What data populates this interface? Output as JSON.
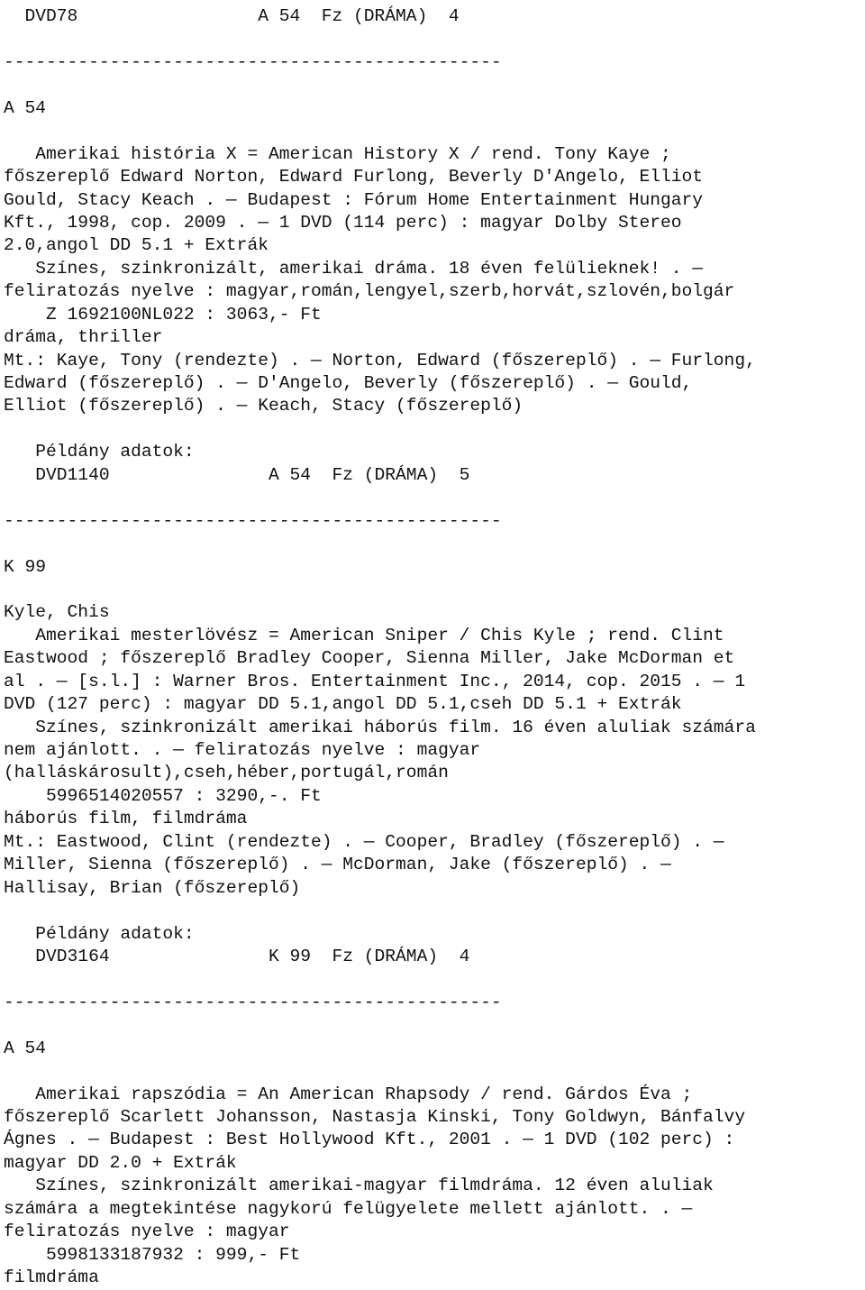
{
  "document": {
    "kind": "library-catalog-printout",
    "language": "hu",
    "separator_rule": "-----------------------------------------------",
    "copy_data_label": "Példány adatok:",
    "records": [
      {
        "id": "record-1",
        "shelf_header": {
          "copy_id": "DVD78",
          "call_number": "A 54",
          "binding": "Fz",
          "genre_code": "(DRÁMA)",
          "count": "4",
          "line": "  DVD78                 A 54  Fz (DRÁMA)  4"
        },
        "call_number_heading": "A 54",
        "body_lines": [
          "   Amerikai história X = American History X / rend. Tony Kaye ;",
          "főszereplő Edward Norton, Edward Furlong, Beverly D'Angelo, Elliot",
          "Gould, Stacy Keach . — Budapest : Fórum Home Entertainment Hungary",
          "Kft., 1998, cop. 2009 . — 1 DVD (114 perc) : magyar Dolby Stereo",
          "2.0,angol DD 5.1 + Extrák",
          "   Színes, szinkronizált, amerikai dráma. 18 éven felülieknek! . —",
          "feliratozás nyelve : magyar,román,lengyel,szerb,horvát,szlovén,bolgár",
          "    Z 1692100NL022 : 3063,- Ft",
          "dráma, thriller",
          "Mt.: Kaye, Tony (rendezte) . — Norton, Edward (főszereplő) . — Furlong,",
          "Edward (főszereplő) . — D'Angelo, Beverly (főszereplő) . — Gould,",
          "Elliot (főszereplő) . — Keach, Stacy (főszereplő)"
        ],
        "copy_block": {
          "label": "   Példány adatok:",
          "row": "   DVD1140               A 54  Fz (DRÁMA)  5",
          "copy_id": "DVD1140",
          "call_number": "A 54",
          "binding": "Fz",
          "genre_code": "(DRÁMA)",
          "count": "5"
        }
      },
      {
        "id": "record-2",
        "call_number_heading": "K 99",
        "author_heading": "Kyle, Chis",
        "body_lines": [
          "   Amerikai mesterlövész = American Sniper / Chis Kyle ; rend. Clint",
          "Eastwood ; főszereplő Bradley Cooper, Sienna Miller, Jake McDorman et",
          "al . — [s.l.] : Warner Bros. Entertainment Inc., 2014, cop. 2015 . — 1",
          "DVD (127 perc) : magyar DD 5.1,angol DD 5.1,cseh DD 5.1 + Extrák",
          "   Színes, szinkronizált amerikai háborús film. 16 éven aluliak számára",
          "nem ajánlott. . — feliratozás nyelve : magyar",
          "(halláskárosult),cseh,héber,portugál,román",
          "    5996514020557 : 3290,-. Ft",
          "háborús film, filmdráma",
          "Mt.: Eastwood, Clint (rendezte) . — Cooper, Bradley (főszereplő) . —",
          "Miller, Sienna (főszereplő) . — McDorman, Jake (főszereplő) . —",
          "Hallisay, Brian (főszereplő)"
        ],
        "copy_block": {
          "label": "   Példány adatok:",
          "row": "   DVD3164               K 99  Fz (DRÁMA)  4",
          "copy_id": "DVD3164",
          "call_number": "K 99",
          "binding": "Fz",
          "genre_code": "(DRÁMA)",
          "count": "4"
        }
      },
      {
        "id": "record-3",
        "call_number_heading": "A 54",
        "body_lines": [
          "   Amerikai rapszódia = An American Rhapsody / rend. Gárdos Éva ;",
          "főszereplő Scarlett Johansson, Nastasja Kinski, Tony Goldwyn, Bánfalvy",
          "Ágnes . — Budapest : Best Hollywood Kft., 2001 . — 1 DVD (102 perc) :",
          "magyar DD 2.0 + Extrák",
          "   Színes, szinkronizált amerikai-magyar filmdráma. 12 éven aluliak",
          "számára a megtekintése nagykorú felügyelete mellett ajánlott. . —",
          "feliratozás nyelve : magyar",
          "    5998133187932 : 999,- Ft",
          "filmdráma"
        ]
      }
    ]
  },
  "rendered_lines": [
    "  DVD78                 A 54  Fz (DRÁMA)  4",
    "",
    "-----------------------------------------------",
    "",
    "A 54",
    "",
    "   Amerikai história X = American History X / rend. Tony Kaye ;",
    "főszereplő Edward Norton, Edward Furlong, Beverly D'Angelo, Elliot",
    "Gould, Stacy Keach . — Budapest : Fórum Home Entertainment Hungary",
    "Kft., 1998, cop. 2009 . — 1 DVD (114 perc) : magyar Dolby Stereo",
    "2.0,angol DD 5.1 + Extrák",
    "   Színes, szinkronizált, amerikai dráma. 18 éven felülieknek! . —",
    "feliratozás nyelve : magyar,román,lengyel,szerb,horvát,szlovén,bolgár",
    "    Z 1692100NL022 : 3063,- Ft",
    "dráma, thriller",
    "Mt.: Kaye, Tony (rendezte) . — Norton, Edward (főszereplő) . — Furlong,",
    "Edward (főszereplő) . — D'Angelo, Beverly (főszereplő) . — Gould,",
    "Elliot (főszereplő) . — Keach, Stacy (főszereplő)",
    "",
    "   Példány adatok:",
    "   DVD1140               A 54  Fz (DRÁMA)  5",
    "",
    "-----------------------------------------------",
    "",
    "K 99",
    "",
    "Kyle, Chis",
    "   Amerikai mesterlövész = American Sniper / Chis Kyle ; rend. Clint",
    "Eastwood ; főszereplő Bradley Cooper, Sienna Miller, Jake McDorman et",
    "al . — [s.l.] : Warner Bros. Entertainment Inc., 2014, cop. 2015 . — 1",
    "DVD (127 perc) : magyar DD 5.1,angol DD 5.1,cseh DD 5.1 + Extrák",
    "   Színes, szinkronizált amerikai háborús film. 16 éven aluliak számára",
    "nem ajánlott. . — feliratozás nyelve : magyar",
    "(halláskárosult),cseh,héber,portugál,román",
    "    5996514020557 : 3290,-. Ft",
    "háborús film, filmdráma",
    "Mt.: Eastwood, Clint (rendezte) . — Cooper, Bradley (főszereplő) . —",
    "Miller, Sienna (főszereplő) . — McDorman, Jake (főszereplő) . —",
    "Hallisay, Brian (főszereplő)",
    "",
    "   Példány adatok:",
    "   DVD3164               K 99  Fz (DRÁMA)  4",
    "",
    "-----------------------------------------------",
    "",
    "A 54",
    "",
    "   Amerikai rapszódia = An American Rhapsody / rend. Gárdos Éva ;",
    "főszereplő Scarlett Johansson, Nastasja Kinski, Tony Goldwyn, Bánfalvy",
    "Ágnes . — Budapest : Best Hollywood Kft., 2001 . — 1 DVD (102 perc) :",
    "magyar DD 2.0 + Extrák",
    "   Színes, szinkronizált amerikai-magyar filmdráma. 12 éven aluliak",
    "számára a megtekintése nagykorú felügyelete mellett ajánlott. . —",
    "feliratozás nyelve : magyar",
    "    5998133187932 : 999,- Ft",
    "filmdráma"
  ]
}
